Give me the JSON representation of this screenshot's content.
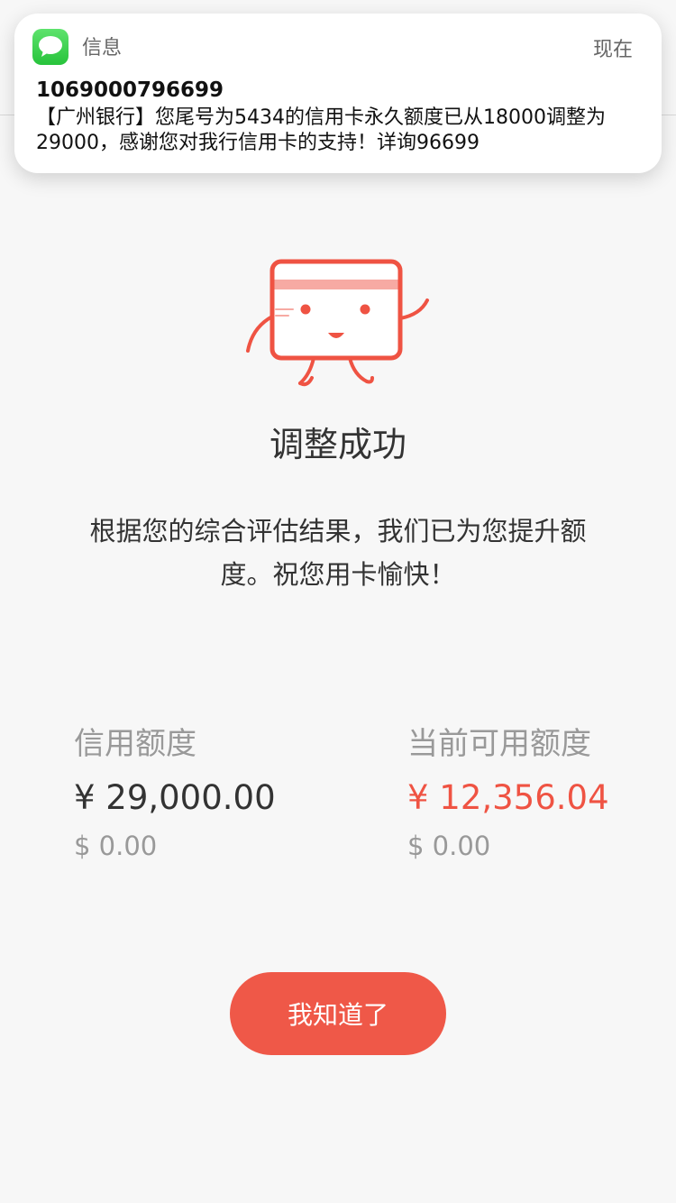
{
  "notification": {
    "app_name": "信息",
    "time": "现在",
    "sender": "1069000796699",
    "message": "【广州银行】您尾号为5434的信用卡永久额度已从18000调整为29000，感谢您对我行信用卡的支持！详询96699",
    "app_icon": "messages-icon"
  },
  "main": {
    "illustration": "credit-card-mascot-icon",
    "title": "调整成功",
    "description": "根据您的综合评估结果，我们已为您提升额度。祝您用卡愉快！"
  },
  "limits": {
    "credit": {
      "label": "信用额度",
      "amount": "¥ 29,000.00",
      "usd": "$ 0.00"
    },
    "available": {
      "label": "当前可用额度",
      "amount": "¥ 12,356.04",
      "usd": "$ 0.00"
    }
  },
  "button": {
    "label": "我知道了"
  },
  "colors": {
    "accent": "#ef5848",
    "available_amount": "#ef5343"
  }
}
